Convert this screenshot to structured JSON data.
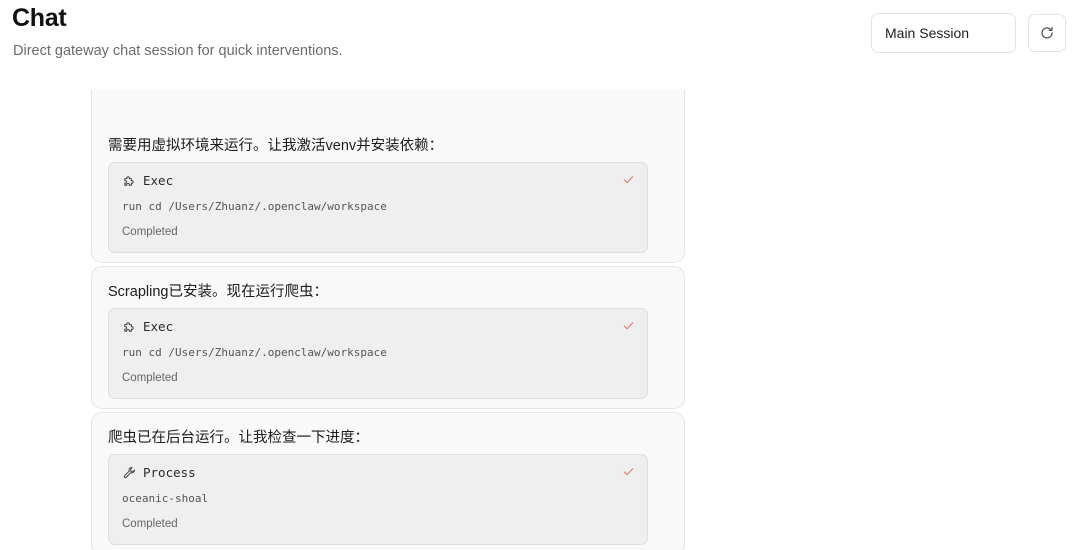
{
  "header": {
    "title": "Chat",
    "subtitle": "Direct gateway chat session for quick interventions.",
    "session_select": "Main Session",
    "refresh_icon": "refresh-icon"
  },
  "messages": [
    {
      "text": "需要用虚拟环境来运行。让我激活venv并安装依赖：",
      "tool": {
        "icon": "puzzle-icon",
        "name": "Exec",
        "detail": "run cd /Users/Zhuanz/.openclaw/workspace",
        "status": "Completed"
      }
    },
    {
      "text": "Scrapling已安装。现在运行爬虫：",
      "tool": {
        "icon": "puzzle-icon",
        "name": "Exec",
        "detail": "run cd /Users/Zhuanz/.openclaw/workspace",
        "status": "Completed"
      }
    },
    {
      "text": "爬虫已在后台运行。让我检查一下进度：",
      "tool": {
        "icon": "wrench-icon",
        "name": "Process",
        "detail": "oceanic-shoal",
        "status": "Completed"
      }
    }
  ],
  "colors": {
    "accent_check": "#e07a6a",
    "card_bg": "#f9f9f9",
    "tool_bg": "#efefef"
  }
}
